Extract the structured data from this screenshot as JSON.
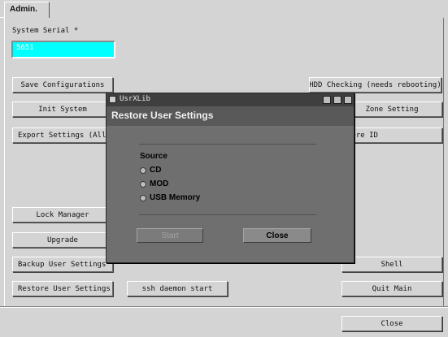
{
  "tab": {
    "label": "Admin."
  },
  "serial": {
    "label": "System Serial *",
    "value": "5651"
  },
  "buttons": {
    "save_config": "Save Configurations",
    "init_system": "Init System",
    "export_settings": "Export Settings (All",
    "lock_manager": "Lock Manager",
    "upgrade": "Upgrade",
    "backup_user": "Backup User Settings",
    "restore_user": "Restore User Settings",
    "ssh_daemon": "ssh daemon start",
    "hdd_checking": "HDD Checking (needs rebooting)",
    "zone_setting": "Zone Setting",
    "core_id": "Core ID",
    "shell": "Shell",
    "quit_main": "Quit Main",
    "close": "Close"
  },
  "dialog": {
    "window_title": "UsrXLib",
    "heading": "Restore User Settings",
    "source_label": "Source",
    "options": [
      "CD",
      "MOD",
      "USB Memory"
    ],
    "start_label": "Start",
    "close_label": "Close"
  },
  "colors": {
    "serial_field": "#00ffff",
    "dialog_bg": "#6f6f6f",
    "panel_bg": "#d4d4d4"
  }
}
